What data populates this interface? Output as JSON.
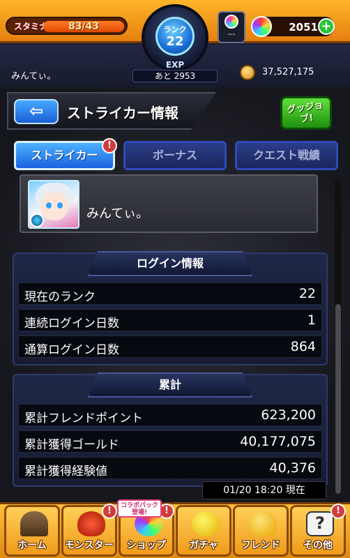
{
  "hud": {
    "stamina_label": "スタミナ",
    "stamina_value": "83/43",
    "rank_label": "ランク",
    "rank_value": "22",
    "exp_label": "EXP",
    "exp_remaining": "あと 2953",
    "medal_count": "---",
    "orb_count": "2051",
    "orb_add_label": "+",
    "player_name": "みんてぃ。",
    "gold": "37,527,175"
  },
  "page": {
    "back_label": "⇦",
    "title": "ストライカー情報",
    "goodjob_label": "グッジョブ!"
  },
  "tabs": [
    {
      "label": "ストライカー",
      "active": true,
      "badge": "!"
    },
    {
      "label": "ボーナス",
      "active": false
    },
    {
      "label": "クエスト戦績",
      "active": false
    }
  ],
  "profile": {
    "name": "みんてぃ。",
    "avatar_icon": "striker-portrait-icon"
  },
  "login_section": {
    "header": "ログイン情報",
    "rows": [
      {
        "label": "現在のランク",
        "value": "22"
      },
      {
        "label": "連続ログイン日数",
        "value": "1"
      },
      {
        "label": "通算ログイン日数",
        "value": "864"
      }
    ]
  },
  "total_section": {
    "header": "累計",
    "rows": [
      {
        "label": "累計フレンドポイント",
        "value": "623,200"
      },
      {
        "label": "累計獲得ゴールド",
        "value": "40,177,075"
      },
      {
        "label": "累計獲得経験値",
        "value": "40,376"
      }
    ]
  },
  "timestamp": "01/20 18:20 現在",
  "bottom_nav": {
    "collab_tag": "コラボパック 登場!",
    "items": [
      {
        "label": "ホーム",
        "icon": "home-icon",
        "badge": ""
      },
      {
        "label": "モンスター",
        "icon": "monster-icon",
        "badge": "!"
      },
      {
        "label": "ショップ",
        "icon": "shop-icon",
        "badge": "!"
      },
      {
        "label": "ガチャ",
        "icon": "gacha-icon",
        "badge": ""
      },
      {
        "label": "フレンド",
        "icon": "friend-icon",
        "badge": ""
      },
      {
        "label": "その他",
        "icon": "other-icon",
        "badge": "!"
      }
    ]
  },
  "colors": {
    "hud_orange": "#f08a12",
    "tab_active": "#1a62e0",
    "panel_bg": "#1f2747",
    "goodjob_green": "#1f8f10"
  },
  "stamina_fraction": 1.0
}
